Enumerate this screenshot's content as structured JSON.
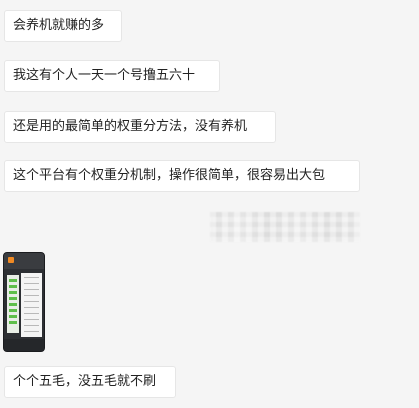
{
  "messages": [
    {
      "text": "会养机就赚的多"
    },
    {
      "text": "我这有个人一天一个号撸五六十"
    },
    {
      "text": "还是用的最简单的权重分方法，没有养机"
    },
    {
      "text": "这个平台有个权重分机制，操作很简单，很容易出大包"
    },
    {
      "text": "个个五毛，没五毛就不刷"
    }
  ],
  "colors": {
    "background": "#f5f5f5",
    "bubble": "#ffffff",
    "text": "#222222",
    "thumb_bg": "#2d2f33",
    "thumb_accent": "#f08a24",
    "thumb_green": "#5fbf4a"
  }
}
